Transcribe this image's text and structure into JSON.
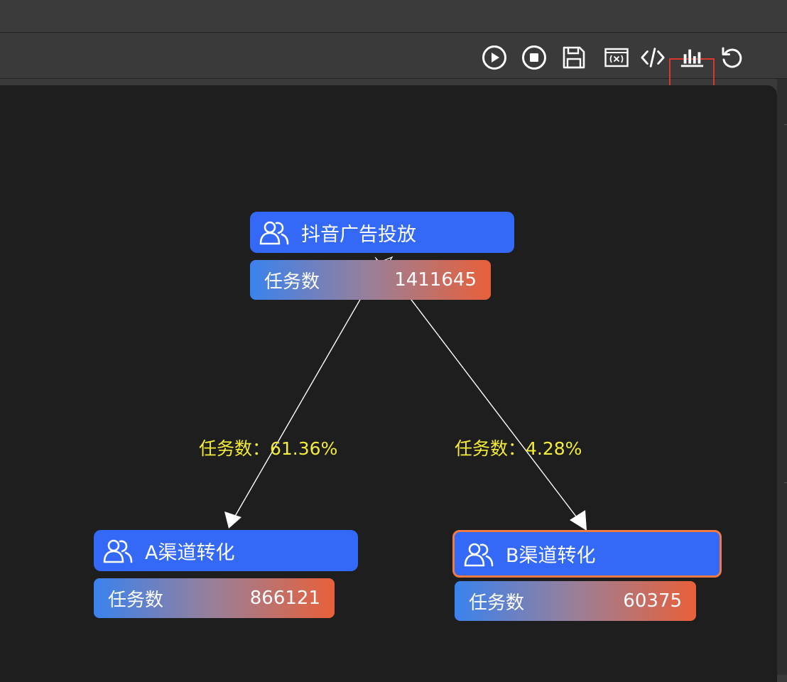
{
  "toolbar": {
    "buttons": [
      {
        "name": "run",
        "icon": "play-circle-icon"
      },
      {
        "name": "stop",
        "icon": "stop-circle-icon"
      },
      {
        "name": "save",
        "icon": "save-icon"
      },
      {
        "name": "variables",
        "icon": "variable-icon"
      },
      {
        "name": "code",
        "icon": "code-icon"
      },
      {
        "name": "statistics",
        "icon": "bar-chart-icon",
        "active": true
      },
      {
        "name": "reset",
        "icon": "refresh-icon"
      }
    ],
    "active_color": "#d9392b"
  },
  "flow": {
    "root": {
      "title": "抖音广告投放",
      "metric_label": "任务数",
      "metric_value": "1411645"
    },
    "children": [
      {
        "title": "A渠道转化",
        "metric_label": "任务数",
        "metric_value": "866121",
        "edge_label": "任务数：61.36%"
      },
      {
        "title": "B渠道转化",
        "metric_label": "任务数",
        "metric_value": "60375",
        "edge_label": "任务数：4.28%",
        "selected": true
      }
    ],
    "colors": {
      "node": "#3369f6",
      "selected_border": "#ee7a45",
      "edge_label": "#f4ec3a",
      "metric_gradient": [
        "#3a82ee",
        "#9a7f98",
        "#e8603a"
      ]
    }
  }
}
